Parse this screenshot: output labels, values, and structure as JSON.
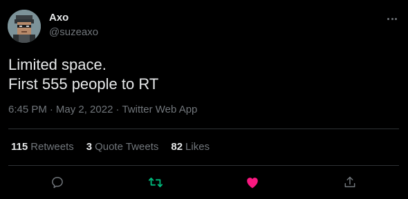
{
  "author": {
    "display_name": "Axo",
    "handle": "@suzeaxo",
    "avatar_icon": "pixel-art-avatar-icon"
  },
  "tweet": {
    "lines": [
      "Limited space.",
      "First 555 people to RT"
    ]
  },
  "meta": {
    "time": "6:45 PM",
    "date": "May 2, 2022",
    "client": "Twitter Web App",
    "separator": "·"
  },
  "stats": [
    {
      "count": "115",
      "label": "Retweets"
    },
    {
      "count": "3",
      "label": "Quote Tweets"
    },
    {
      "count": "82",
      "label": "Likes"
    }
  ],
  "actions": {
    "reply_icon": "reply-icon",
    "retweet_icon": "retweet-icon",
    "like_icon": "heart-icon",
    "share_icon": "share-icon"
  },
  "colors": {
    "background": "#000000",
    "text": "#e7e9ea",
    "secondary": "#71767b",
    "retweet_active": "#00ba7c",
    "like_active": "#f91880",
    "divider": "#2f3336"
  }
}
